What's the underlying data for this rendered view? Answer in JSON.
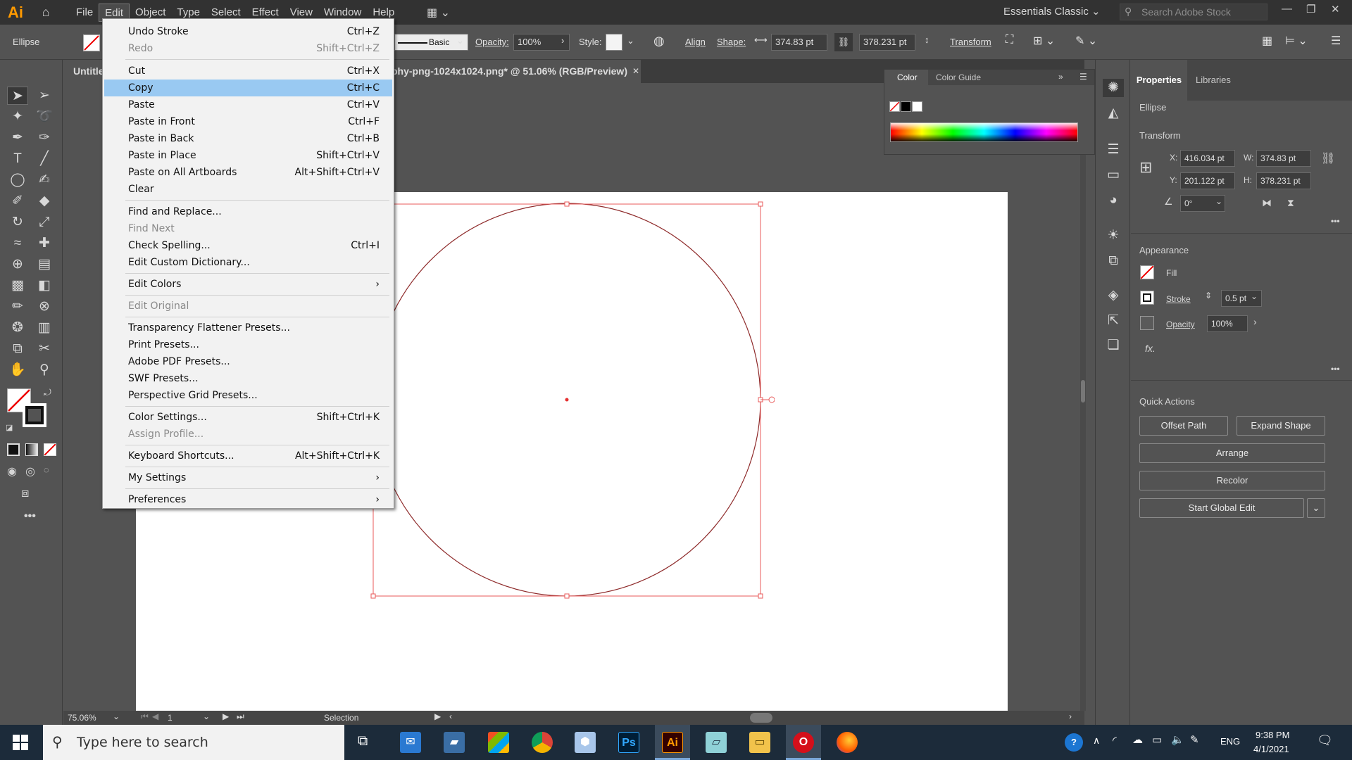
{
  "menubar": {
    "app_logo": "Ai",
    "items": [
      "File",
      "Edit",
      "Object",
      "Type",
      "Select",
      "Effect",
      "View",
      "Window",
      "Help"
    ],
    "workspace": "Essentials Classic",
    "stock_placeholder": "Search Adobe Stock"
  },
  "controlbar": {
    "selection_type": "Ellipse",
    "stroke_profile": "Basic",
    "opacity_label": "Opacity:",
    "opacity_value": "100%",
    "style_label": "Style:",
    "align_label": "Align",
    "shape_label": "Shape:",
    "width_value": "374.83 pt",
    "height_value": "378.231 pt",
    "transform_label": "Transform"
  },
  "document": {
    "tab_prefix": "Untitle",
    "tab_title": "phy-png-1024x1024.png* @ 51.06% (RGB/Preview)"
  },
  "color_panel": {
    "tabs": [
      "Color",
      "Color Guide"
    ]
  },
  "properties": {
    "tabs": [
      "Properties",
      "Libraries"
    ],
    "object_type": "Ellipse",
    "transform_title": "Transform",
    "x_label": "X:",
    "x_value": "416.034 pt",
    "y_label": "Y:",
    "y_value": "201.122 pt",
    "w_label": "W:",
    "w_value": "374.83 pt",
    "h_label": "H:",
    "h_value": "378.231 pt",
    "rotate_value": "0°",
    "appearance_title": "Appearance",
    "fill_label": "Fill",
    "stroke_label": "Stroke",
    "stroke_value": "0.5 pt",
    "opacity_label": "Opacity",
    "opacity_value": "100%",
    "fx_label": "fx.",
    "quick_actions_title": "Quick Actions",
    "buttons": [
      "Offset Path",
      "Expand Shape",
      "Arrange",
      "Recolor",
      "Start Global Edit"
    ]
  },
  "status": {
    "zoom": "75.06%",
    "artboard": "1",
    "tool": "Selection"
  },
  "edit_menu": {
    "items": [
      {
        "label": "Undo Stroke",
        "shortcut": "Ctrl+Z",
        "disabled": false
      },
      {
        "label": "Redo",
        "shortcut": "Shift+Ctrl+Z",
        "disabled": true
      },
      {
        "label": "Cut",
        "shortcut": "Ctrl+X",
        "disabled": false
      },
      {
        "label": "Copy",
        "shortcut": "Ctrl+C",
        "disabled": false,
        "highlighted": true
      },
      {
        "label": "Paste",
        "shortcut": "Ctrl+V",
        "disabled": false
      },
      {
        "label": "Paste in Front",
        "shortcut": "Ctrl+F",
        "disabled": false
      },
      {
        "label": "Paste in Back",
        "shortcut": "Ctrl+B",
        "disabled": false
      },
      {
        "label": "Paste in Place",
        "shortcut": "Shift+Ctrl+V",
        "disabled": false
      },
      {
        "label": "Paste on All Artboards",
        "shortcut": "Alt+Shift+Ctrl+V",
        "disabled": false
      },
      {
        "label": "Clear",
        "shortcut": "",
        "disabled": false
      },
      {
        "label": "Find and Replace...",
        "shortcut": "",
        "disabled": false
      },
      {
        "label": "Find Next",
        "shortcut": "",
        "disabled": true
      },
      {
        "label": "Check Spelling...",
        "shortcut": "Ctrl+I",
        "disabled": false
      },
      {
        "label": "Edit Custom Dictionary...",
        "shortcut": "",
        "disabled": false
      },
      {
        "label": "Edit Colors",
        "shortcut": "",
        "disabled": false,
        "submenu": true
      },
      {
        "label": "Edit Original",
        "shortcut": "",
        "disabled": true
      },
      {
        "label": "Transparency Flattener Presets...",
        "shortcut": "",
        "disabled": false
      },
      {
        "label": "Print Presets...",
        "shortcut": "",
        "disabled": false
      },
      {
        "label": "Adobe PDF Presets...",
        "shortcut": "",
        "disabled": false
      },
      {
        "label": "SWF Presets...",
        "shortcut": "",
        "disabled": false
      },
      {
        "label": "Perspective Grid Presets...",
        "shortcut": "",
        "disabled": false
      },
      {
        "label": "Color Settings...",
        "shortcut": "Shift+Ctrl+K",
        "disabled": false
      },
      {
        "label": "Assign Profile...",
        "shortcut": "",
        "disabled": true
      },
      {
        "label": "Keyboard Shortcuts...",
        "shortcut": "Alt+Shift+Ctrl+K",
        "disabled": false
      },
      {
        "label": "My Settings",
        "shortcut": "",
        "disabled": false,
        "submenu": true
      },
      {
        "label": "Preferences",
        "shortcut": "",
        "disabled": false,
        "submenu": true
      }
    ]
  },
  "taskbar": {
    "search_placeholder": "Type here to search",
    "ps_label": "Ps",
    "ai_label": "Ai",
    "lang": "ENG",
    "time": "9:38 PM",
    "date": "4/1/2021"
  },
  "colors": {
    "selection": "#e85a5a",
    "menu_highlight": "#99c9f2",
    "ui_dark": "#535353"
  }
}
